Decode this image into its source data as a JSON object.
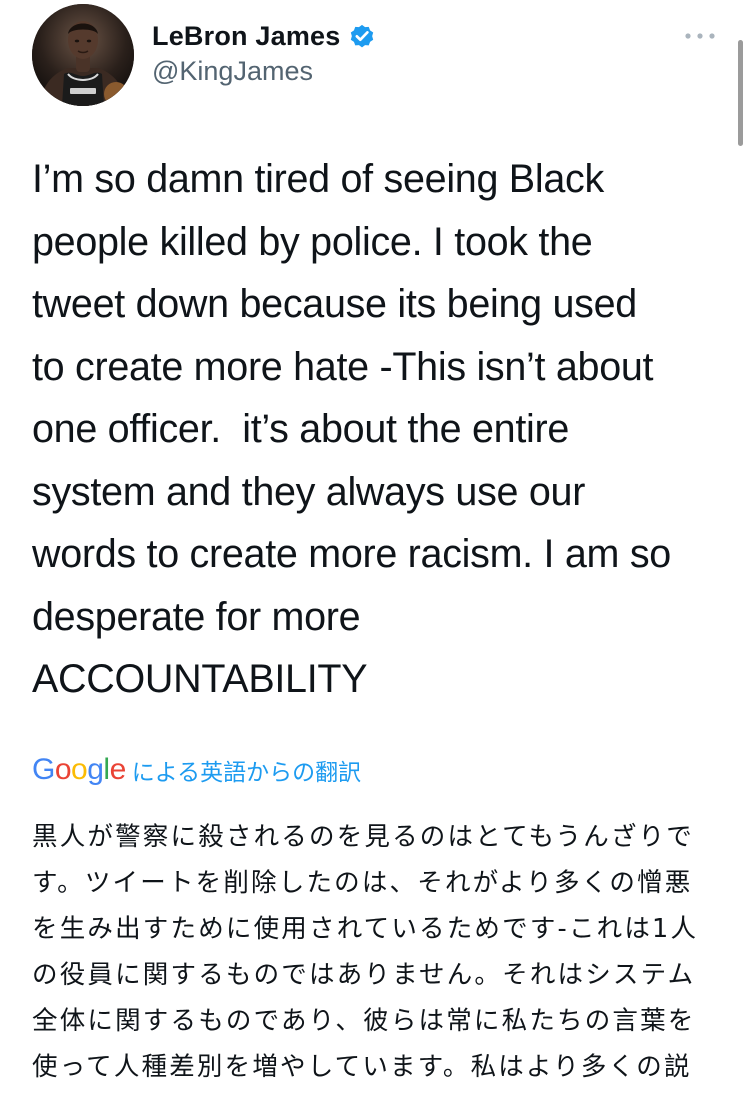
{
  "tweet": {
    "author": {
      "display_name": "LeBron James",
      "handle": "@KingJames",
      "verified": true,
      "avatar_icon": "profile-photo"
    },
    "more_icon": "ellipsis-icon",
    "text_lines": [
      "I’m so damn tired of seeing Black",
      "people killed by police. I took the",
      "tweet down because its being used",
      "to create more hate -This isn’t about",
      "one officer.  it’s about the entire",
      "system and they always use our",
      "words to create more racism. I am so",
      "desperate for more",
      "ACCOUNTABILITY"
    ],
    "translation": {
      "provider_logo": "Google",
      "note": "による英語からの翻訳",
      "text_lines": [
        "黒人が警察に殺されるのを見るのはとてもうんざりで",
        "す。ツイートを削除したのは、それがより多くの憎悪",
        "を生み出すために使用されているためです-これは1人",
        "の役員に関するものではありません。それはシステム",
        "全体に関するものであり、彼らは常に私たちの言葉を",
        "使って人種差別を増やしています。私はより多くの説"
      ]
    }
  },
  "colors": {
    "text_primary": "#0f1419",
    "text_secondary": "#536471",
    "accent_blue": "#1d9bf0",
    "google_blue": "#4285F4",
    "google_red": "#EA4335",
    "google_yellow": "#FBBC05",
    "google_green": "#34A853"
  }
}
